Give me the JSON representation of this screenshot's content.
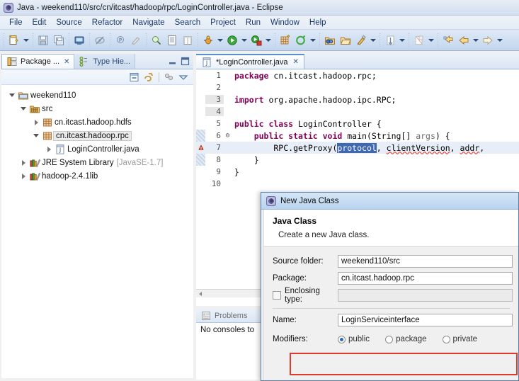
{
  "window": {
    "title": "Java - weekend110/src/cn/itcast/hadoop/rpc/LoginController.java - Eclipse",
    "icon": "eclipse-icon"
  },
  "menubar": {
    "items": [
      {
        "label": "File"
      },
      {
        "label": "Edit"
      },
      {
        "label": "Source"
      },
      {
        "label": "Refactor"
      },
      {
        "label": "Navigate"
      },
      {
        "label": "Search"
      },
      {
        "label": "Project"
      },
      {
        "label": "Run"
      },
      {
        "label": "Window"
      },
      {
        "label": "Help"
      }
    ]
  },
  "toolbar": {
    "groups": [
      {
        "buttons": [
          {
            "icon": "new-wizard-icon",
            "dropdown": true
          },
          {
            "icon": "save-icon",
            "dropdown": false
          },
          {
            "icon": "save-all-icon",
            "dropdown": false
          },
          {
            "icon": "print-icon",
            "dropdown": false
          }
        ]
      },
      {
        "buttons": [
          {
            "icon": "toggle-mark-occurrences-icon",
            "dropdown": false
          },
          {
            "icon": "annotation-icon",
            "dropdown": false
          },
          {
            "icon": "quick-fix-icon",
            "dropdown": false
          },
          {
            "icon": "search-class-icon",
            "dropdown": false
          },
          {
            "icon": "open-task-icon",
            "dropdown": false
          },
          {
            "icon": "column-icon",
            "dropdown": false
          }
        ]
      },
      {
        "buttons": [
          {
            "icon": "debug-icon",
            "dropdown": true
          },
          {
            "icon": "run-icon",
            "dropdown": true
          },
          {
            "icon": "external-tools-icon",
            "dropdown": true
          }
        ]
      },
      {
        "buttons": [
          {
            "icon": "new-java-project-icon",
            "dropdown": false
          },
          {
            "icon": "new-java-class-icon",
            "dropdown": true
          }
        ]
      },
      {
        "buttons": [
          {
            "icon": "open-type-icon",
            "dropdown": false
          },
          {
            "icon": "open-folder-icon",
            "dropdown": false
          },
          {
            "icon": "format-icon",
            "dropdown": true
          }
        ]
      },
      {
        "buttons": [
          {
            "icon": "next-annotation-icon",
            "dropdown": true
          },
          {
            "icon": "previous-annotation-icon",
            "dropdown": true
          }
        ]
      },
      {
        "buttons": [
          {
            "icon": "last-edit-location-icon",
            "dropdown": false
          },
          {
            "icon": "back-icon",
            "dropdown": true
          },
          {
            "icon": "forward-icon",
            "dropdown": true
          }
        ]
      }
    ]
  },
  "left_panel": {
    "tabs": [
      {
        "label": "Package ...",
        "icon": "package-explorer-icon",
        "active": true,
        "closable": true
      },
      {
        "label": "Type Hie...",
        "icon": "type-hierarchy-icon",
        "active": false,
        "closable": false
      }
    ],
    "window_buttons": [
      {
        "icon": "minimize-icon"
      },
      {
        "icon": "maximize-icon"
      }
    ],
    "view_toolbar": [
      {
        "icon": "collapse-all-icon"
      },
      {
        "icon": "link-with-editor-icon"
      },
      {
        "icon": "focus-on-active-task-icon"
      },
      {
        "icon": "view-menu-icon"
      }
    ],
    "tree": [
      {
        "indent": 0,
        "twist": "open",
        "icon": "project-icon",
        "label": "weekend110",
        "suffix": "",
        "selected": false
      },
      {
        "indent": 1,
        "twist": "open",
        "icon": "source-folder-icon",
        "label": "src",
        "suffix": "",
        "selected": false
      },
      {
        "indent": 2,
        "twist": "closed",
        "icon": "package-icon",
        "label": "cn.itcast.hadoop.hdfs",
        "suffix": "",
        "selected": false
      },
      {
        "indent": 2,
        "twist": "open",
        "icon": "package-icon",
        "label": "cn.itcast.hadoop.rpc",
        "suffix": "",
        "selected": true
      },
      {
        "indent": 3,
        "twist": "closed",
        "icon": "java-file-icon",
        "label": "LoginController.java",
        "suffix": "",
        "selected": false
      },
      {
        "indent": 1,
        "twist": "closed",
        "icon": "library-icon",
        "label": "JRE System Library",
        "suffix": "[JavaSE-1.7]",
        "selected": false
      },
      {
        "indent": 1,
        "twist": "closed",
        "icon": "library-icon",
        "label": "hadoop-2.4.1lib",
        "suffix": "",
        "selected": false
      }
    ]
  },
  "editor": {
    "tabs": [
      {
        "label": "*LoginController.java",
        "icon": "java-file-icon",
        "active": true,
        "closable": true
      }
    ],
    "lines": [
      {
        "num": "1",
        "fold": "",
        "marker": "none",
        "gutter_shade": false,
        "highlight": false,
        "tokens": [
          {
            "t": "package",
            "c": "kw"
          },
          {
            "t": " cn.itcast.hadoop.rpc;",
            "c": "plain"
          }
        ]
      },
      {
        "num": "2",
        "fold": "",
        "marker": "none",
        "gutter_shade": false,
        "highlight": false,
        "tokens": []
      },
      {
        "num": "3",
        "fold": "",
        "marker": "none",
        "gutter_shade": true,
        "highlight": false,
        "tokens": [
          {
            "t": "import",
            "c": "kw"
          },
          {
            "t": " org.apache.hadoop.ipc.RPC;",
            "c": "plain"
          }
        ]
      },
      {
        "num": "4",
        "fold": "",
        "marker": "none",
        "gutter_shade": true,
        "highlight": false,
        "tokens": []
      },
      {
        "num": "5",
        "fold": "",
        "marker": "none",
        "gutter_shade": false,
        "highlight": false,
        "tokens": [
          {
            "t": "public class",
            "c": "kw"
          },
          {
            "t": " LoginController {",
            "c": "plain"
          }
        ]
      },
      {
        "num": "6",
        "fold": "⊖",
        "marker": "stripe",
        "gutter_shade": false,
        "highlight": false,
        "tokens": [
          {
            "t": "    ",
            "c": "plain"
          },
          {
            "t": "public static void",
            "c": "kw"
          },
          {
            "t": " main(String[] ",
            "c": "plain"
          },
          {
            "t": "args",
            "c": "param"
          },
          {
            "t": ") {",
            "c": "plain"
          }
        ]
      },
      {
        "num": "7",
        "fold": "",
        "marker": "error",
        "gutter_shade": false,
        "highlight": true,
        "tokens": [
          {
            "t": "        RPC.getProxy(",
            "c": "plain"
          },
          {
            "t": "protocol",
            "c": "selw"
          },
          {
            "t": ", ",
            "c": "plain"
          },
          {
            "t": "clientVersion",
            "c": "squig"
          },
          {
            "t": ", ",
            "c": "plain"
          },
          {
            "t": "addr",
            "c": "squig"
          },
          {
            "t": ",",
            "c": "plain"
          }
        ]
      },
      {
        "num": "8",
        "fold": "",
        "marker": "stripe",
        "gutter_shade": false,
        "highlight": false,
        "tokens": [
          {
            "t": "    }",
            "c": "plain"
          }
        ]
      },
      {
        "num": "9",
        "fold": "",
        "marker": "none",
        "gutter_shade": false,
        "highlight": false,
        "tokens": [
          {
            "t": "}",
            "c": "plain"
          }
        ]
      },
      {
        "num": "10",
        "fold": "",
        "marker": "none",
        "gutter_shade": false,
        "highlight": false,
        "tokens": []
      }
    ]
  },
  "bottom_panel": {
    "tabs": [
      {
        "label": "Problems",
        "icon": "problems-icon"
      }
    ],
    "message": "No consoles to"
  },
  "dialog": {
    "title": "New Java Class",
    "title_icon": "eclipse-icon",
    "heading": "Java Class",
    "subheading": "Create a new Java class.",
    "fields": [
      {
        "label": "Source folder:",
        "value": "weekend110/src",
        "type": "text",
        "disabled": false
      },
      {
        "label": "Package:",
        "value": "cn.itcast.hadoop.rpc",
        "type": "text",
        "disabled": false
      },
      {
        "label": "Enclosing type:",
        "value": "",
        "type": "checkbox-text",
        "disabled": true,
        "checked": false
      }
    ],
    "name_field": {
      "label": "Name:",
      "value": "LoginServiceinterface",
      "highlight_color": "#e03a2f"
    },
    "modifiers": {
      "label": "Modifiers:",
      "options": [
        {
          "label": "public",
          "selected": true
        },
        {
          "label": "package",
          "selected": false
        },
        {
          "label": "private",
          "selected": false
        }
      ]
    }
  },
  "colors": {
    "accent": "#3f68b0",
    "keyword": "#7f0055",
    "string": "#2a00ff",
    "error": "#e04a3f",
    "highlight_box": "#e03a2f"
  }
}
